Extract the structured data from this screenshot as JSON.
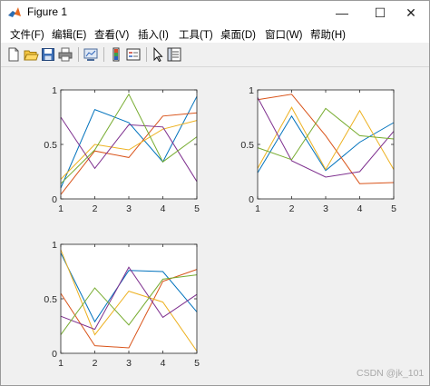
{
  "window": {
    "title": "Figure 1",
    "controls": {
      "minimize": "—",
      "maximize": "☐",
      "close": "✕"
    }
  },
  "menu": [
    "文件(F)",
    "编辑(E)",
    "查看(V)",
    "插入(I)",
    "工具(T)",
    "桌面(D)",
    "窗口(W)",
    "帮助(H)"
  ],
  "toolbar_icons": [
    "new-figure-icon",
    "open-file-icon",
    "save-icon",
    "print-icon",
    "link-plot-icon",
    "insert-colorbar-icon",
    "insert-legend-icon",
    "pointer-icon",
    "property-inspector-icon"
  ],
  "colors": [
    "#0072BD",
    "#D95319",
    "#EDB120",
    "#7E2F8E",
    "#77AC30"
  ],
  "chart_data": [
    {
      "type": "line",
      "x": [
        1,
        2,
        3,
        4,
        5
      ],
      "xlim": [
        1,
        5
      ],
      "ylim": [
        0,
        1
      ],
      "xticks": [
        "1",
        "2",
        "3",
        "4",
        "5"
      ],
      "yticks": [
        "0",
        "0.5",
        "1"
      ],
      "series": [
        {
          "values": [
            0.1,
            0.82,
            0.7,
            0.34,
            0.94
          ]
        },
        {
          "values": [
            0.04,
            0.44,
            0.38,
            0.76,
            0.79
          ]
        },
        {
          "values": [
            0.18,
            0.5,
            0.45,
            0.64,
            0.72
          ]
        },
        {
          "values": [
            0.75,
            0.28,
            0.68,
            0.66,
            0.16
          ]
        },
        {
          "values": [
            0.14,
            0.45,
            0.96,
            0.34,
            0.57
          ]
        }
      ]
    },
    {
      "type": "line",
      "x": [
        1,
        2,
        3,
        4,
        5
      ],
      "xlim": [
        1,
        5
      ],
      "ylim": [
        0,
        1
      ],
      "xticks": [
        "1",
        "2",
        "3",
        "4",
        "5"
      ],
      "yticks": [
        "0",
        "0.5",
        "1"
      ],
      "series": [
        {
          "values": [
            0.24,
            0.76,
            0.26,
            0.52,
            0.7
          ]
        },
        {
          "values": [
            0.91,
            0.96,
            0.58,
            0.14,
            0.15
          ]
        },
        {
          "values": [
            0.28,
            0.84,
            0.27,
            0.81,
            0.27
          ]
        },
        {
          "values": [
            0.93,
            0.35,
            0.2,
            0.25,
            0.62
          ]
        },
        {
          "values": [
            0.47,
            0.36,
            0.83,
            0.58,
            0.55
          ]
        }
      ]
    },
    {
      "type": "line",
      "x": [
        1,
        2,
        3,
        4,
        5
      ],
      "xlim": [
        1,
        5
      ],
      "ylim": [
        0,
        1
      ],
      "xticks": [
        "1",
        "2",
        "3",
        "4",
        "5"
      ],
      "yticks": [
        "0",
        "0.5",
        "1"
      ],
      "series": [
        {
          "values": [
            0.92,
            0.29,
            0.76,
            0.75,
            0.38
          ]
        },
        {
          "values": [
            0.55,
            0.07,
            0.05,
            0.66,
            0.77
          ]
        },
        {
          "values": [
            0.95,
            0.17,
            0.57,
            0.47,
            0.02
          ]
        },
        {
          "values": [
            0.34,
            0.22,
            0.79,
            0.33,
            0.54
          ]
        },
        {
          "values": [
            0.17,
            0.6,
            0.26,
            0.68,
            0.72
          ]
        }
      ]
    }
  ],
  "watermark": "CSDN @jk_101"
}
